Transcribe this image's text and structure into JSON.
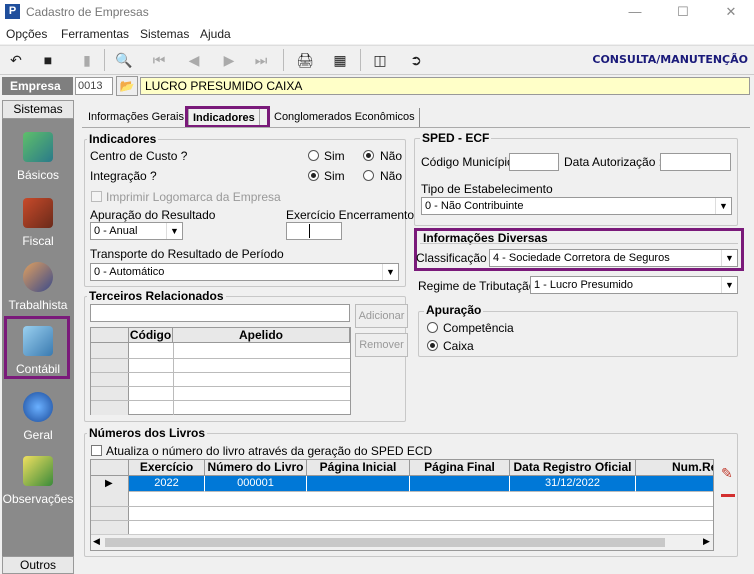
{
  "window": {
    "title": "Cadastro de Empresas",
    "icon_letter": "P"
  },
  "menu": [
    "Opções",
    "Ferramentas",
    "Sistemas",
    "Ajuda"
  ],
  "toolbar": {
    "mode_label": "CONSULTA/MANUTENÇÃO"
  },
  "empresa": {
    "label": "Empresa",
    "code": "0013",
    "name": "LUCRO PRESUMIDO CAIXA"
  },
  "sidebar": {
    "header": "Sistemas",
    "footer": "Outros",
    "items": [
      "Básicos",
      "Fiscal",
      "Trabalhista",
      "Contábil",
      "Geral",
      "Observações"
    ],
    "selected": "Contábil"
  },
  "tabs": [
    "Informações Gerais",
    "Indicadores",
    "Conglomerados Econômicos"
  ],
  "active_tab": "Indicadores",
  "indicadores": {
    "title": "Indicadores",
    "centro_custo": {
      "label": "Centro de Custo ?",
      "sim": "Sim",
      "nao": "Não",
      "value": "Não"
    },
    "integracao": {
      "label": "Integração ?",
      "sim": "Sim",
      "nao": "Não",
      "value": "Sim"
    },
    "imprimir_logo": "Imprimir Logomarca da Empresa",
    "apuracao_resultado": {
      "label": "Apuração do Resultado",
      "value": "0 - Anual"
    },
    "exercicio_encerramento": {
      "label": "Exercício Encerramento"
    },
    "transporte": {
      "label": "Transporte do Resultado de Período",
      "value": "0 - Automático"
    }
  },
  "sped": {
    "title": "SPED - ECF",
    "codigo_municipio": "Código Município :",
    "data_autorizacao": "Data Autorização :",
    "tipo_estabelecimento": {
      "label": "Tipo de Estabelecimento",
      "value": "0 - Não Contribuinte"
    }
  },
  "info_diversas": {
    "title": "Informações Diversas",
    "classificacao": {
      "label": "Classificação :",
      "value": "4 - Sociedade Corretora de Seguros"
    }
  },
  "regime": {
    "label": "Regime de Tributação :",
    "value": "1 - Lucro Presumido"
  },
  "apuracao": {
    "title": "Apuração",
    "competencia": "Competência",
    "caixa": "Caixa",
    "value": "Caixa"
  },
  "terceiros": {
    "title": "Terceiros Relacionados",
    "add_label": "Adicionar",
    "remove_label": "Remover",
    "columns": [
      "Código",
      "Apelido"
    ]
  },
  "livros": {
    "title": "Números dos Livros",
    "checkbox_label": "Atualiza o número do livro através da geração do SPED ECD",
    "columns": [
      "Exercício",
      "Número do Livro",
      "Página Inicial",
      "Página Final",
      "Data Registro Oficial",
      "Num.Re"
    ],
    "rows": [
      [
        "2022",
        "000001",
        "",
        "",
        "31/12/2022",
        ""
      ]
    ]
  }
}
